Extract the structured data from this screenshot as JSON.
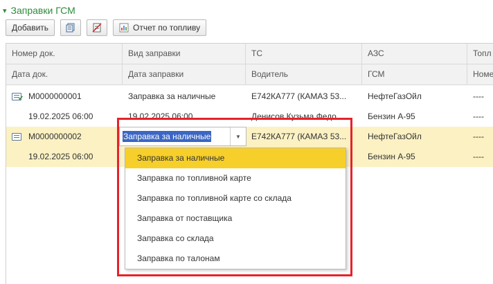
{
  "section": {
    "title": "Заправки ГСМ"
  },
  "toolbar": {
    "add_label": "Добавить",
    "report_label": "Отчет по топливу"
  },
  "columns_row1": [
    "Номер док.",
    "Вид заправки",
    "ТС",
    "АЗС",
    "Топл"
  ],
  "columns_row2": [
    "Дата док.",
    "Дата заправки",
    "Водитель",
    "ГСМ",
    "Номе"
  ],
  "rows": [
    {
      "num": "М0000000001",
      "kind": "Заправка за наличные",
      "ts": "Е742КА777 (КАМАЗ 53...",
      "azs": "НефтеГазОйл",
      "fuel": "----",
      "doc_date": "19.02.2025 06:00",
      "fill_date": "19.02.2025 06:00",
      "driver": "Денисов Кузьма Федо...",
      "gsm": "Бензин А-95",
      "card": "----"
    },
    {
      "num": "М0000000002",
      "kind": "Заправка за наличные",
      "ts": "Е742КА777 (КАМАЗ 53...",
      "azs": "НефтеГазОйл",
      "fuel": "----",
      "doc_date": "19.02.2025 06:00",
      "fill_date": "",
      "driver": "",
      "gsm": "Бензин А-95",
      "card": "----"
    }
  ],
  "dropdown": {
    "options": [
      "Заправка за наличные",
      "Заправка по топливной карте",
      "Заправка по топливной карте со склада",
      "Заправка от поставщика",
      "Заправка со склада",
      "Заправка по талонам"
    ],
    "selected_index": 0
  },
  "colors": {
    "accent_green": "#2e8b3a",
    "selection_row": "#fbf1c3",
    "option_active": "#f7cf2a",
    "highlight_border": "#e6222a",
    "text_selection": "#3b66c4"
  }
}
